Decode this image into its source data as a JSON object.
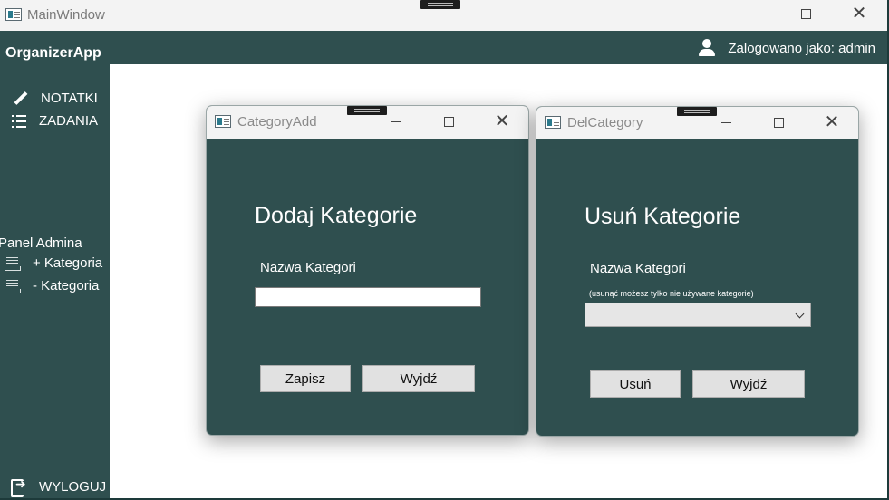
{
  "main": {
    "title": "MainWindow",
    "brand": "OrganizerApp",
    "user_text": "Zalogowano jako: admin"
  },
  "sidebar": {
    "notes_label": "NOTATKI",
    "tasks_label": "ZADANIA",
    "admin_panel_label": "Panel Admina",
    "add_category_label": "+ Kategoria",
    "remove_category_label": "- Kategoria",
    "logout_label": "WYLOGUJ"
  },
  "category_add": {
    "title": "CategoryAdd",
    "heading": "Dodaj Kategorie",
    "name_label": "Nazwa Kategori",
    "name_value": "",
    "save_label": "Zapisz",
    "exit_label": "Wyjdź"
  },
  "del_category": {
    "title": "DelCategory",
    "heading": "Usuń Kategorie",
    "name_label": "Nazwa Kategori",
    "note": "(usunąć możesz tylko nie używane kategorie)",
    "selected": "",
    "delete_label": "Usuń",
    "exit_label": "Wyjdź"
  },
  "colors": {
    "panel": "#2f4f4f",
    "titlebar": "#f3f3f3",
    "button": "#e1e1e1"
  }
}
